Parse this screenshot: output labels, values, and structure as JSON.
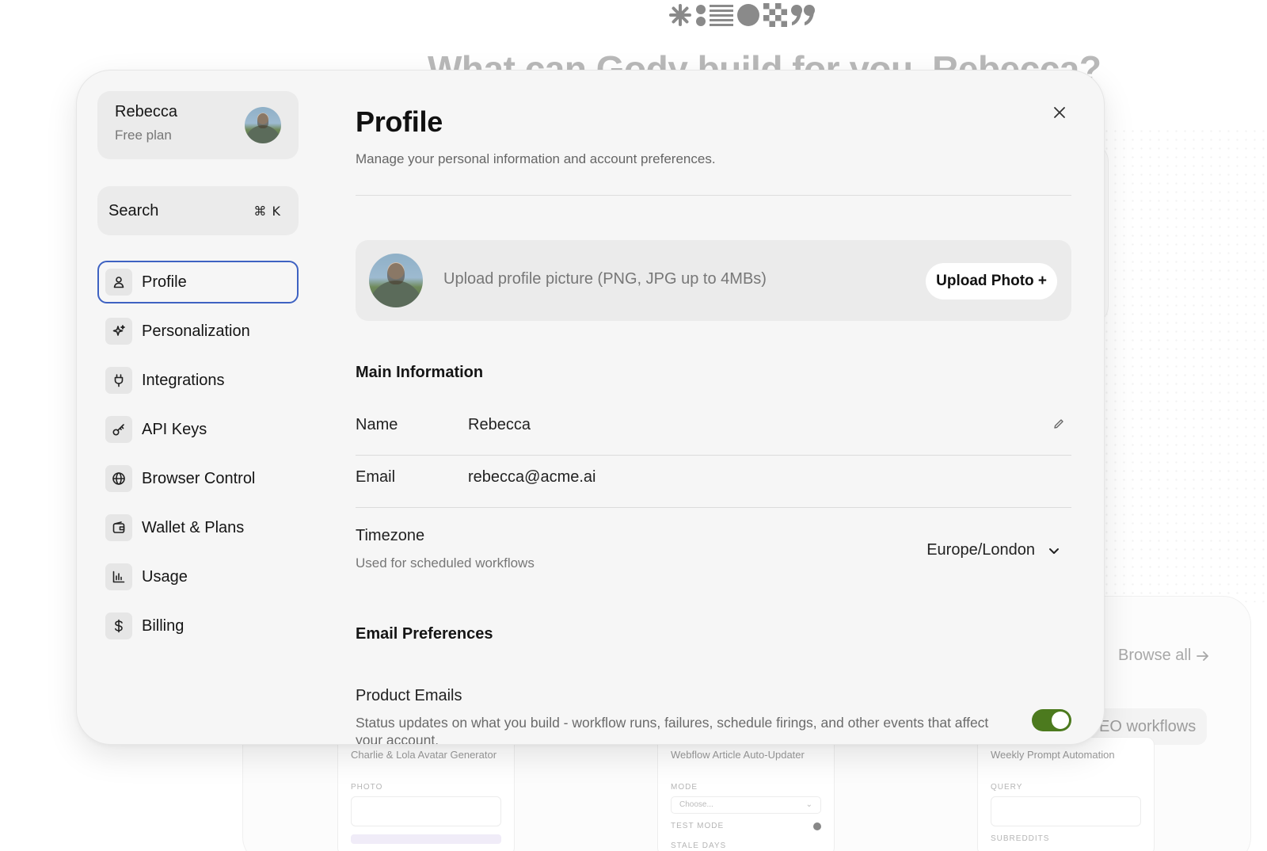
{
  "background": {
    "headline": "What can Gody build for you, Rebecca?",
    "browse_all": "Browse all",
    "workflows_chip": "EO workflows",
    "cards": [
      {
        "title": "Charlie & Lola Avatar Generator",
        "field_label": "PHOTO"
      },
      {
        "title": "Webflow Article Auto-Updater",
        "field_label": "MODE",
        "select_placeholder": "Choose...",
        "toggle_label": "TEST MODE",
        "trailing_label": "STALE DAYS"
      },
      {
        "title": "Weekly Prompt Automation",
        "field_label": "QUERY",
        "second_label": "SUBREDDITS"
      }
    ]
  },
  "sidebar": {
    "user": {
      "name": "Rebecca",
      "plan": "Free plan"
    },
    "search": {
      "label": "Search",
      "shortcut": "⌘ K"
    },
    "items": [
      {
        "label": "Profile",
        "icon": "user-icon",
        "active": true
      },
      {
        "label": "Personalization",
        "icon": "sparkles-icon"
      },
      {
        "label": "Integrations",
        "icon": "plug-icon"
      },
      {
        "label": "API Keys",
        "icon": "key-icon"
      },
      {
        "label": "Browser Control",
        "icon": "globe-icon"
      },
      {
        "label": "Wallet & Plans",
        "icon": "wallet-icon"
      },
      {
        "label": "Usage",
        "icon": "bar-chart-icon"
      },
      {
        "label": "Billing",
        "icon": "dollar-icon"
      }
    ]
  },
  "profile": {
    "title": "Profile",
    "subtitle": "Manage your personal information and account preferences.",
    "upload": {
      "hint": "Upload profile picture (PNG, JPG up to 4MBs)",
      "button": "Upload Photo +"
    },
    "main_info": {
      "title": "Main Information",
      "name_label": "Name",
      "name_value": "Rebecca",
      "email_label": "Email",
      "email_value": "rebecca@acme.ai",
      "timezone_label": "Timezone",
      "timezone_sub": "Used for scheduled workflows",
      "timezone_value": "Europe/London"
    },
    "email_prefs": {
      "title": "Email Preferences",
      "product_label": "Product Emails",
      "product_desc": "Status updates on what you build - workflow runs, failures, schedule firings, and other events that affect your account.",
      "product_enabled": true
    }
  },
  "colors": {
    "accent_border": "#3e62c2",
    "toggle_on": "#4c7a1e"
  }
}
